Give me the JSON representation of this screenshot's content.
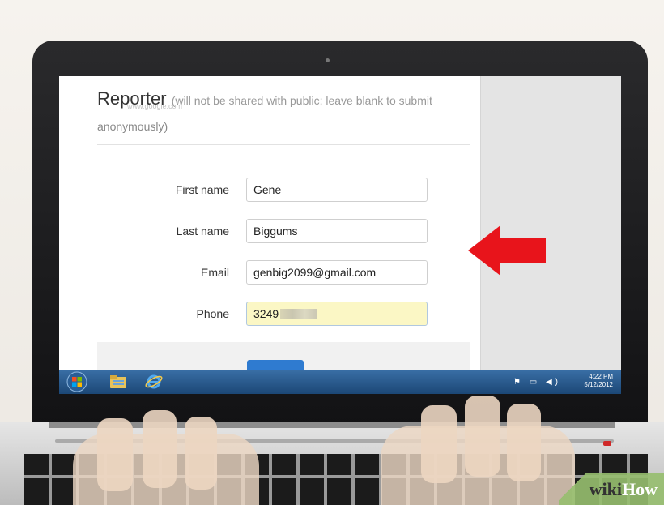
{
  "form": {
    "section_title": "Reporter",
    "section_note": "(will not be shared with public; leave blank to submit",
    "section_note_line2": "anonymously)",
    "watermark": "www.google.com",
    "fields": [
      {
        "label": "First name",
        "value": "Gene"
      },
      {
        "label": "Last name",
        "value": "Biggums"
      },
      {
        "label": "Email",
        "value": "genbig2099@gmail.com"
      },
      {
        "label": "Phone",
        "value": "3249"
      }
    ]
  },
  "taskbar": {
    "time": "4:22 PM",
    "date": "5/12/2012",
    "icons": [
      "windows-start-orb",
      "file-explorer-icon",
      "internet-explorer-icon"
    ]
  },
  "overlay": {
    "arrow_color": "#e8141b",
    "brand_wiki": "wiki",
    "brand_how": "How"
  }
}
